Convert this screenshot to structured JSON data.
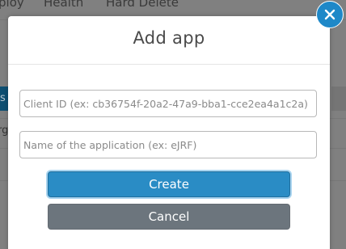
{
  "background": {
    "tabs": [
      "ploy",
      "Health",
      "Hard Delete"
    ],
    "left_block_text": "s",
    "left_row_text": "rg"
  },
  "modal": {
    "title": "Add app",
    "client_id_placeholder": "Client ID (ex: cb36754f-20a2-47a9-bba1-cce2ea4a1c2a)",
    "client_id_value": "",
    "app_name_placeholder": "Name of the application (ex: eJRF)",
    "app_name_value": "",
    "create_label": "Create",
    "cancel_label": "Cancel"
  },
  "icons": {
    "close": "close-icon"
  },
  "colors": {
    "primary": "#2a8cc5",
    "secondary": "#6c757d",
    "close_button": "#1e88c8"
  }
}
